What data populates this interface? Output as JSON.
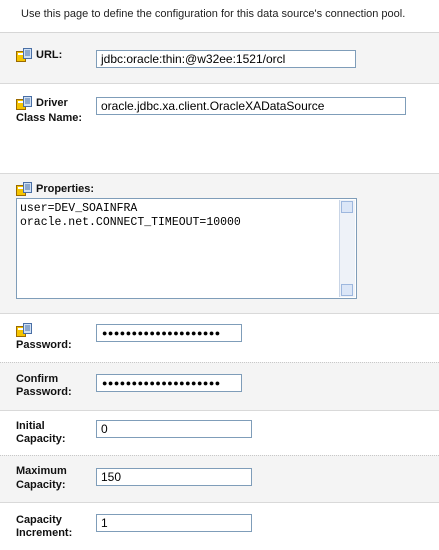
{
  "description": "Use this page to define the configuration for this data source's connection pool.",
  "url": {
    "label": "URL:",
    "value": "jdbc:oracle:thin:@w32ee:1521/orcl"
  },
  "driver": {
    "label_line1": "Driver",
    "label_line2": "Class Name:",
    "value": "oracle.jdbc.xa.client.OracleXADataSource"
  },
  "properties": {
    "label": "Properties:",
    "line1": "user=DEV_SOAINFRA",
    "line2": "oracle.net.CONNECT_TIMEOUT=10000"
  },
  "password": {
    "label": "Password:",
    "masked": "●●●●●●●●●●●●●●●●●●●●"
  },
  "confirm_password": {
    "label_line1": "Confirm",
    "label_line2": "Password:",
    "masked": "●●●●●●●●●●●●●●●●●●●●"
  },
  "initial_capacity": {
    "label_line1": "Initial",
    "label_line2": "Capacity:",
    "value": "0"
  },
  "maximum_capacity": {
    "label_line1": "Maximum",
    "label_line2": "Capacity:",
    "value": "150"
  },
  "capacity_increment": {
    "label_line1": "Capacity",
    "label_line2": "Increment:",
    "value": "1"
  },
  "icons": {
    "field_help": "field-help-icon"
  }
}
